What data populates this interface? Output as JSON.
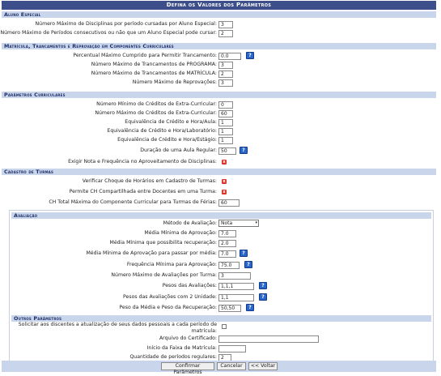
{
  "title": "Defina os Valores dos Parâmetros",
  "sections": {
    "aluno_especial": "Aluno Especial",
    "matricula": "Matrícula, Trancamentos e Reprovação em Componentes Curriculares",
    "curriculares": "Parâmetros Curriculares",
    "turmas": "Cadastro de Turmas",
    "avaliacao": "Avaliação",
    "outros": "Outros Parâmetros"
  },
  "aluno_especial": {
    "max_disciplinas": {
      "label": "Número Máximo de Disciplinas por período cursadas por Aluno Especial:",
      "value": "3"
    },
    "max_periodos": {
      "label": "Número Máximo de Períodos consecutivos ou não que um Aluno Especial pode cursar:",
      "value": "2"
    }
  },
  "matricula": {
    "percentual_trancamento": {
      "label": "Percentual Máximo Cumprido para Permitir Trancamento:",
      "value": "0.0"
    },
    "trancamentos_programa": {
      "label": "Número Máximo de Trancamentos de PROGRAMA:",
      "value": "3"
    },
    "trancamentos_matricula": {
      "label": "Número Máximo de Trancamentos de MATRÍCULA:",
      "value": "2"
    },
    "reprovacoes": {
      "label": "Número Máximo de Reprovações:",
      "value": "3"
    }
  },
  "curriculares": {
    "min_extra": {
      "label": "Número Mínimo de Créditos de Extra-Curricular:",
      "value": "0"
    },
    "max_extra": {
      "label": "Número Máximo de Créditos de Extra-Curricular:",
      "value": "60"
    },
    "equiv_aula": {
      "label": "Equivalência de Crédito e Hora/Aula:",
      "value": "1"
    },
    "equiv_lab": {
      "label": "Equivalência de Crédito e Hora/Laboratório:",
      "value": "1"
    },
    "equiv_estagio": {
      "label": "Equivalência de Crédito e Hora/Estágio:",
      "value": "1"
    },
    "duracao_aula": {
      "label": "Duração de uma Aula Regular:",
      "value": "50"
    },
    "exigir_nota": {
      "label": "Exigir Nota e Frequência no Aproveitamento de Disciplinas:"
    }
  },
  "turmas": {
    "choque": {
      "label": "Verificar Choque de Horários em Cadastro de Turmas:"
    },
    "ch_compartilhada": {
      "label": "Permite CH Compartilhada entre Docentes em uma Turma:"
    },
    "ch_ferias": {
      "label": "CH Total Máxima do Componente Curricular para Turmas de Férias:",
      "value": "60"
    }
  },
  "avaliacao": {
    "metodo": {
      "label": "Método de Avaliação:",
      "value": "Nota"
    },
    "media_aprovacao": {
      "label": "Média Mínima de Aprovação:",
      "value": "7.0"
    },
    "media_recuperacao": {
      "label": "Média Mínima que possibilita recuperação:",
      "value": "2.0"
    },
    "media_passar": {
      "label": "Média Mínima de Aprovação para passar por média:",
      "value": "7.0"
    },
    "frequencia": {
      "label": "Frequência Mínima para Aprovação:",
      "value": "75.0"
    },
    "max_avaliacoes": {
      "label": "Número Máximo de Avaliações por Turma:",
      "value": "3"
    },
    "pesos": {
      "label": "Pesos das Avaliações:",
      "value": "1,1,1"
    },
    "pesos_2": {
      "label": "Pesos das Avaliações com 2 Unidade:",
      "value": "1,1"
    },
    "peso_media_rec": {
      "label": "Peso da Média e Peso da Recuperação:",
      "value": "50,50"
    }
  },
  "outros": {
    "atualizacao": {
      "label_line1": "Solicitar aos discentes a atualização de seus dados pessoais a cada período de",
      "label_line2": "matrícula:"
    },
    "certificado": {
      "label": "Arquivo do Certificado:",
      "value": ""
    },
    "inicio_faixa": {
      "label": "Início da Faixa de Matrícula:",
      "value": ""
    },
    "periodos_regulares": {
      "label": "Quantidade de períodos regulares:",
      "value": "2"
    }
  },
  "buttons": {
    "confirmar": "Confirmar Parâmetros",
    "cancelar": "Cancelar",
    "voltar": "<< Voltar"
  },
  "help_glyph": "?",
  "x_glyph": "x",
  "colors": {
    "header": "#3c4f8a",
    "section": "#c9d5ea",
    "help": "#2a66c9",
    "x_mark": "#d9352a"
  }
}
